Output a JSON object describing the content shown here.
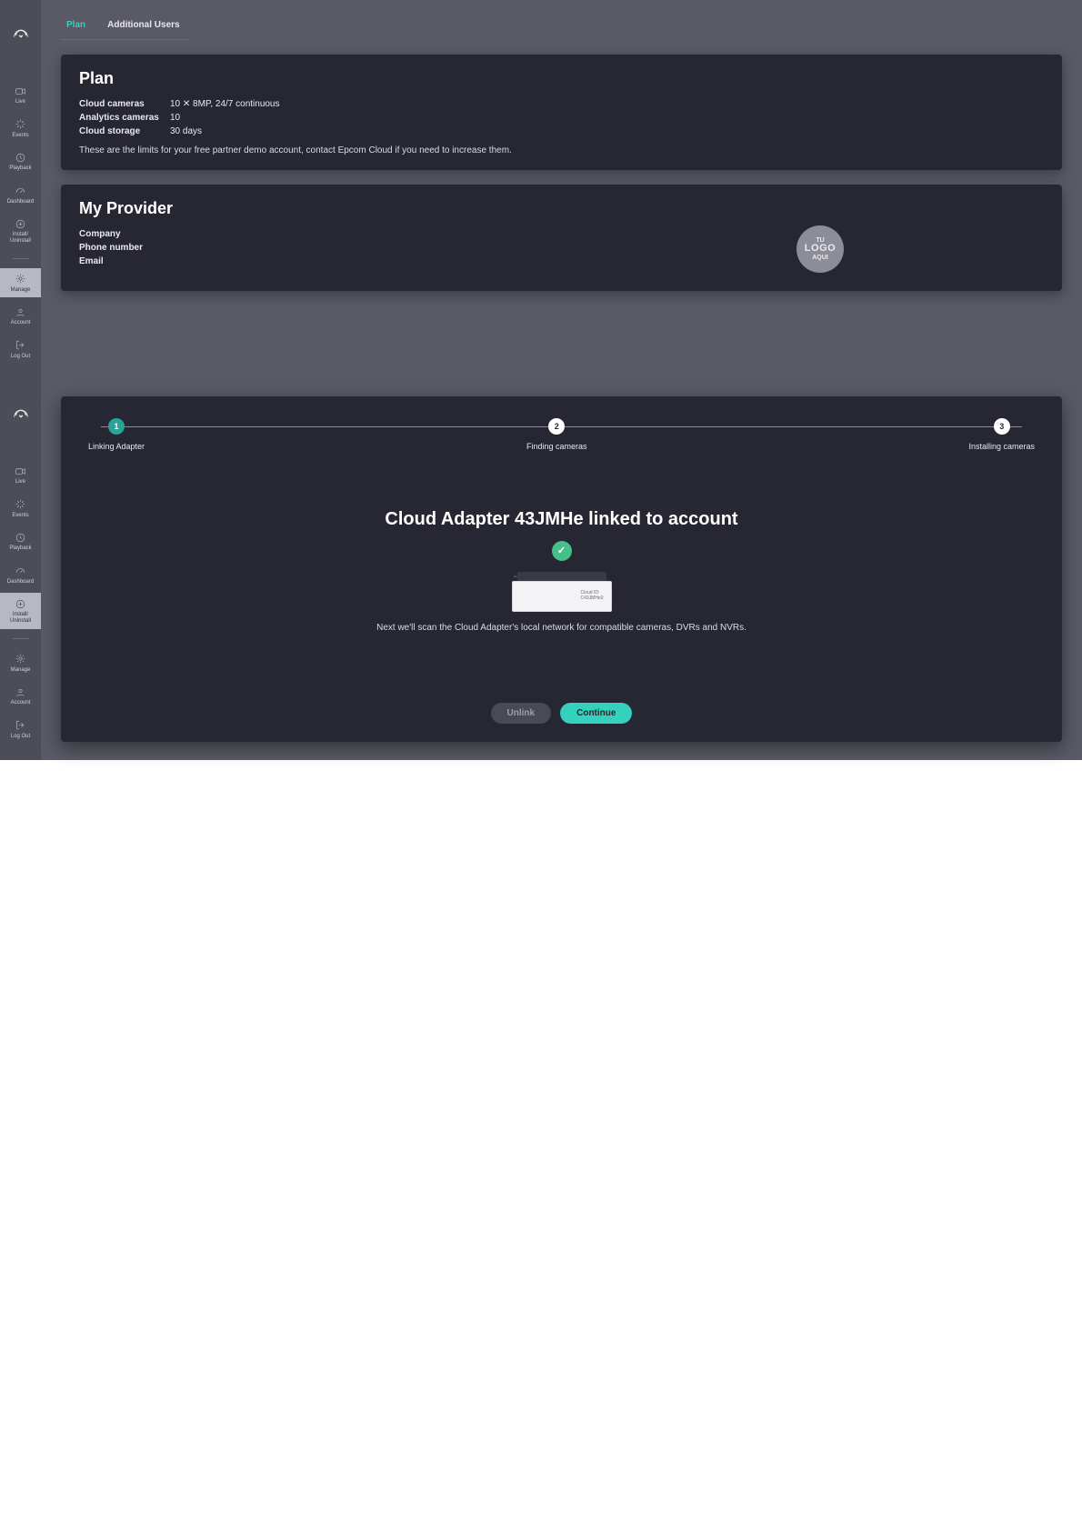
{
  "sidebar_top": {
    "brand": "epcom",
    "items": [
      {
        "label": "Live",
        "icon": "camera"
      },
      {
        "label": "Events",
        "icon": "sparkles"
      },
      {
        "label": "Playback",
        "icon": "rewind"
      },
      {
        "label": "Dashboard",
        "icon": "gauge"
      },
      {
        "label": "Install/\nUninstall",
        "icon": "plus-circle"
      }
    ],
    "items_bottom": [
      {
        "label": "Manage",
        "icon": "gear"
      },
      {
        "label": "Account",
        "icon": "user"
      },
      {
        "label": "Log Out",
        "icon": "logout"
      }
    ],
    "active_top": "Manage",
    "active_wiz": "Install/\nUninstall"
  },
  "tabs": {
    "plan": "Plan",
    "additional": "Additional Users"
  },
  "plan": {
    "title": "Plan",
    "rows": [
      {
        "k": "Cloud cameras",
        "v": "10 ✕ 8MP, 24/7 continuous"
      },
      {
        "k": "Analytics cameras",
        "v": "10"
      },
      {
        "k": "Cloud storage",
        "v": "30 days"
      }
    ],
    "note": "These are the limits for your free partner demo account, contact Epcom Cloud if you need to increase them."
  },
  "provider": {
    "title": "My Provider",
    "rows": [
      {
        "k": "Company",
        "v": ""
      },
      {
        "k": "Phone number",
        "v": ""
      },
      {
        "k": "Email",
        "v": ""
      }
    ],
    "logo": {
      "line1": "TU",
      "line2": "LOGO",
      "line3": "AQUI"
    }
  },
  "wizard": {
    "steps": [
      {
        "n": "1",
        "label": "Linking Adapter"
      },
      {
        "n": "2",
        "label": "Finding cameras"
      },
      {
        "n": "3",
        "label": "Installing cameras"
      }
    ],
    "title": "Cloud Adapter 43JMHe linked to account",
    "device_tag_1": "Cloud ID:",
    "device_tag_2": "C43JMHe0",
    "subtitle": "Next we'll scan the Cloud Adapter's local network for compatible cameras, DVRs and NVRs.",
    "unlink": "Unlink",
    "continue": "Continue"
  }
}
